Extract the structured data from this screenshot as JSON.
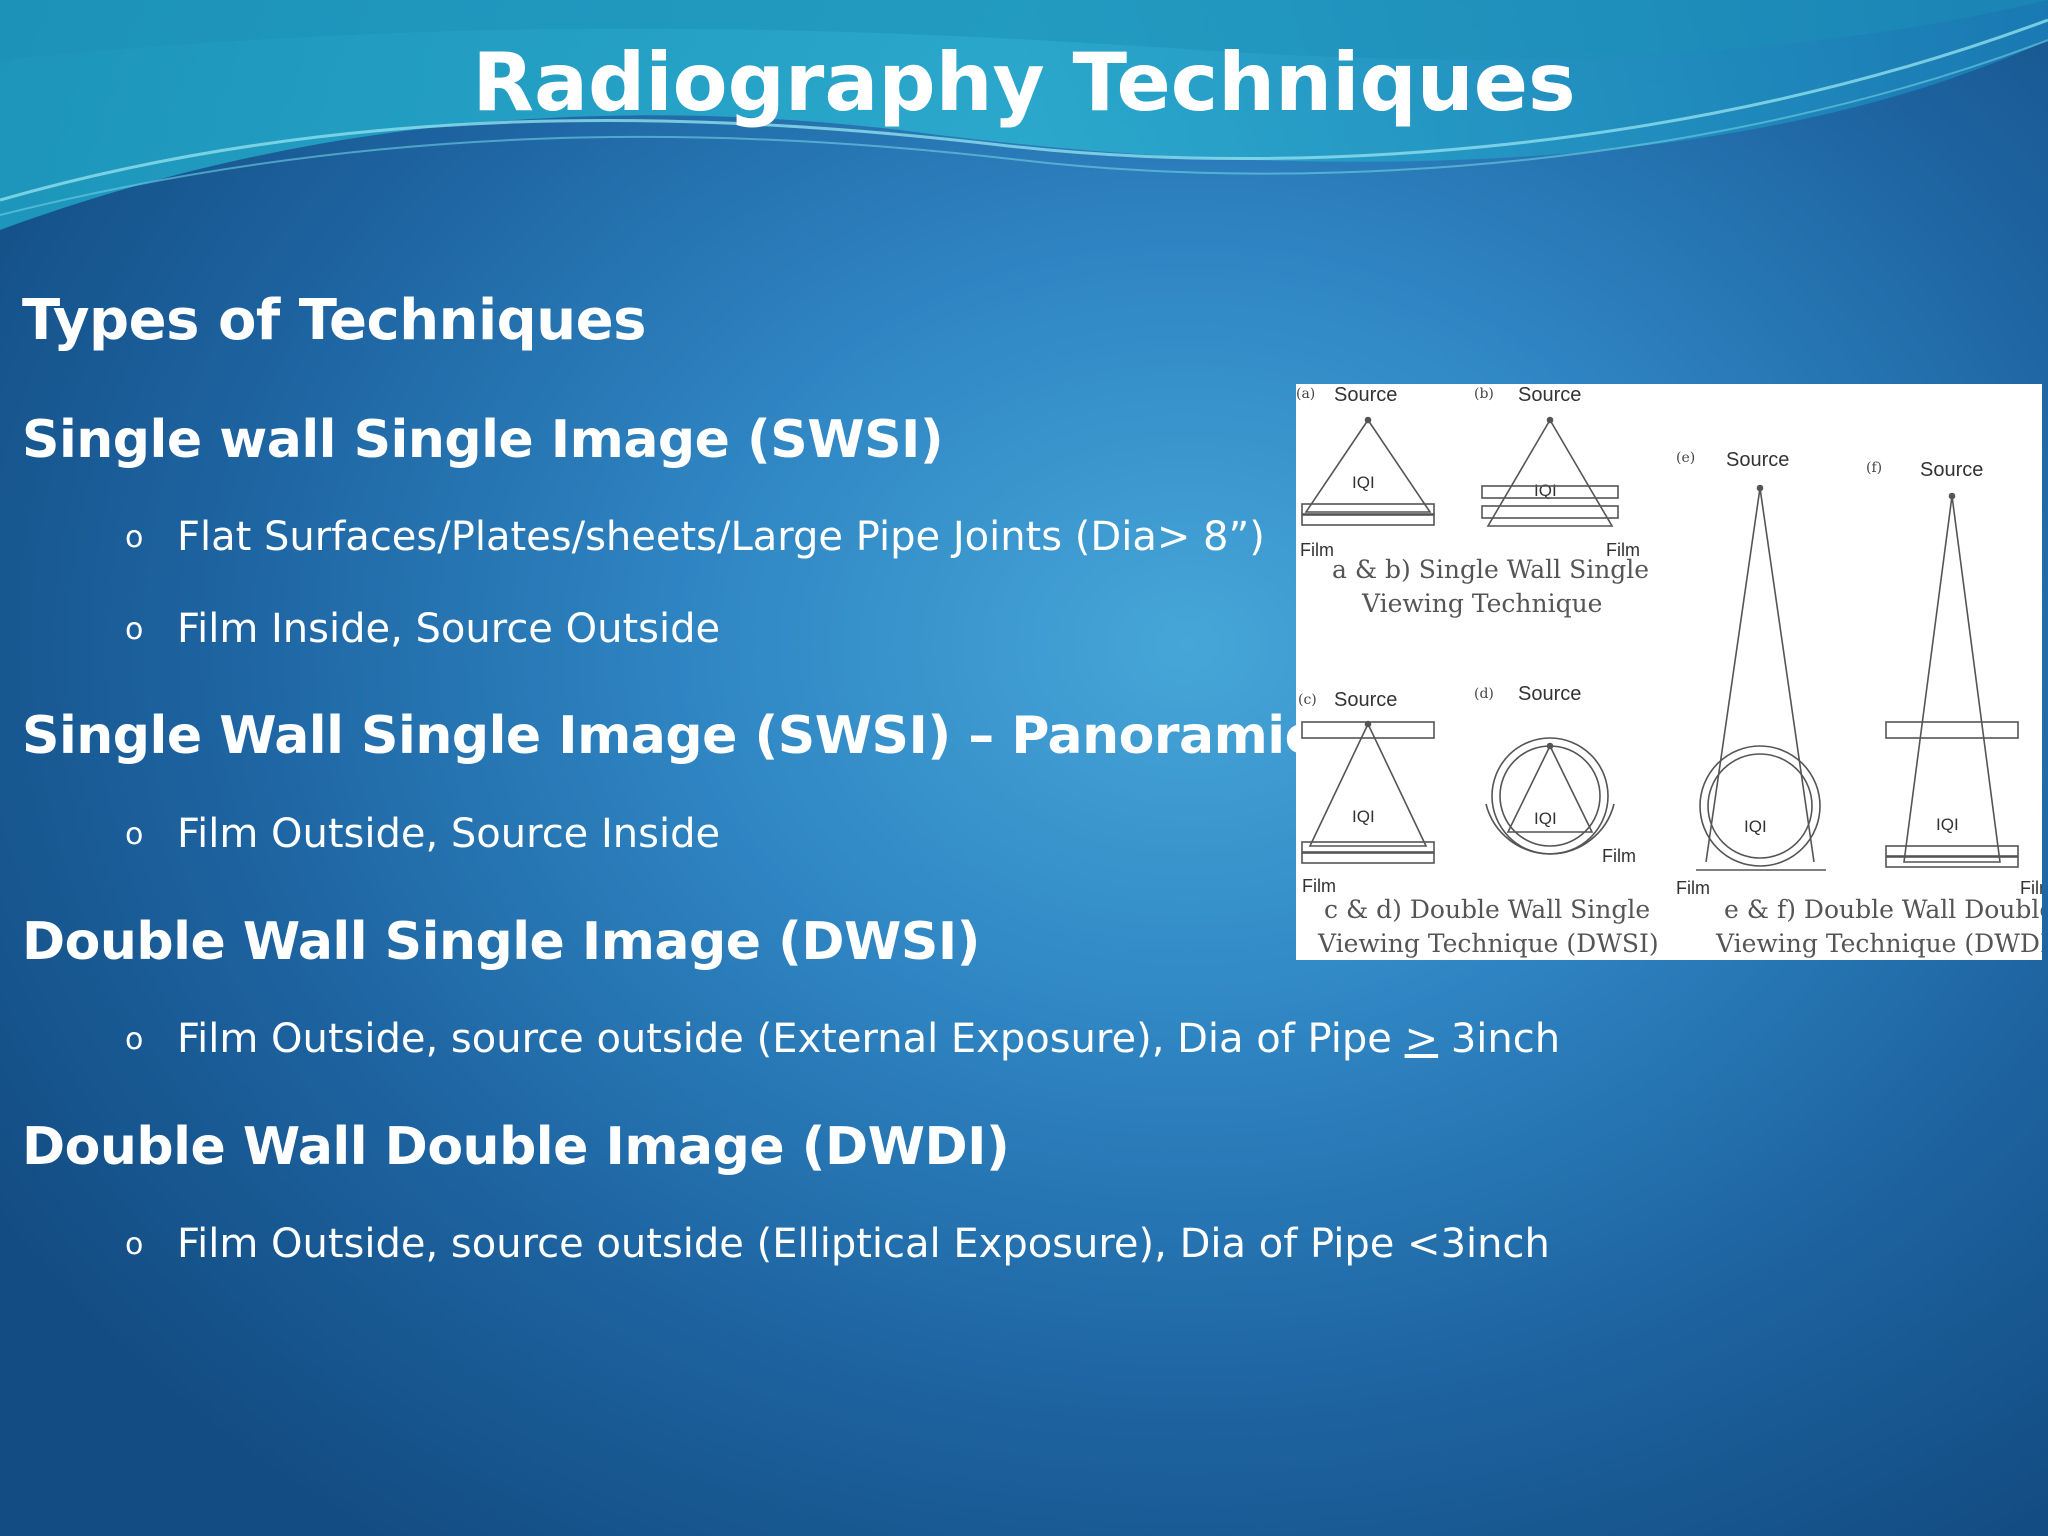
{
  "slide": {
    "title": "Radiography Techniques",
    "subtitle": "Types of Techniques",
    "sections": [
      {
        "heading": "Single wall Single Image (SWSI)",
        "bullets": [
          "Flat Surfaces/Plates/sheets/Large Pipe Joints (Dia> 8”)",
          "Film Inside, Source Outside"
        ]
      },
      {
        "heading": "Single Wall Single Image (SWSI) – Panoramic",
        "bullets": [
          "Film Outside, Source Inside"
        ]
      },
      {
        "heading": "Double Wall Single Image (DWSI)",
        "bullets": [
          "Film Outside, source outside (External Exposure), Dia of Pipe ",
          "3inch"
        ],
        "ge_symbol": ">"
      },
      {
        "heading": "Double Wall Double Image (DWDI)",
        "bullets": [
          "Film Outside, source outside (Elliptical  Exposure), Dia of Pipe <3inch"
        ]
      }
    ],
    "bullet_glyph": "o"
  },
  "figure": {
    "panel_tags": [
      "(a)",
      "(b)",
      "(c)",
      "(d)",
      "(e)",
      "(f)"
    ],
    "source_label": "Source",
    "iqi_label": "IQI",
    "film_label": "Film",
    "captions": {
      "ab_line1": "a & b) Single Wall Single",
      "ab_line2": "Viewing Technique",
      "cd_line1": "c & d) Double Wall Single",
      "cd_line2": "Viewing Technique (DWSI)",
      "ef_line1": "e & f) Double Wall Double",
      "ef_line2": "Viewing Technique (DWDI)"
    }
  }
}
